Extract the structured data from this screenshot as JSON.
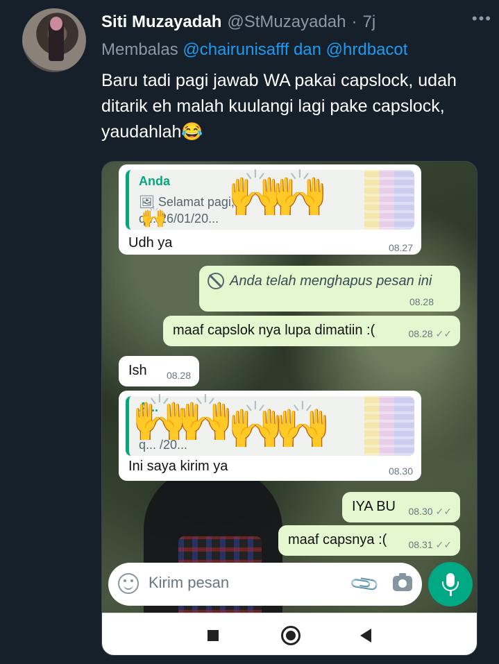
{
  "tweet": {
    "author_name": "Siti Muzayadah",
    "author_handle": "@StMuzayadah",
    "separator": "·",
    "time_ago": "7j",
    "more_label": "•••",
    "replying_prefix": "Membalas",
    "replying_to": "@chairunisafff dan @hrdbacot",
    "text": "Baru tadi pagi jawab WA pakai capslock, udah ditarik eh malah kuulangi lagi pake capslock, yaudahlah😂"
  },
  "chat": {
    "messages": [
      {
        "direction": "in",
        "quote": {
          "author": "Anda",
          "line1": "🖼 Selamat pagi, ...",
          "line2": "q... 26/01/20..."
        },
        "text": "Udh ya",
        "time": "08.27"
      },
      {
        "direction": "out",
        "deleted": true,
        "deleted_icon": "prohibited-icon",
        "text": "Anda telah menghapus pesan ini",
        "time": "08.28"
      },
      {
        "direction": "out",
        "text": "maaf capslok nya lupa dimatiin :(",
        "time": "08.28",
        "ticks": "✓✓"
      },
      {
        "direction": "in",
        "text": "Ish",
        "time": "08.28"
      },
      {
        "direction": "in",
        "quote": {
          "author": "A...",
          "line1": "...",
          "line2": "q... /20..."
        },
        "text": "Ini saya kirim ya",
        "time": "08.30"
      },
      {
        "direction": "out",
        "text": "IYA BU",
        "time": "08.30",
        "ticks": "✓✓"
      },
      {
        "direction": "out",
        "text": "maaf capsnya :(",
        "time": "08.31",
        "ticks": "✓✓"
      }
    ],
    "input_placeholder": "Kirim pesan",
    "censor_emoji": "🙌"
  },
  "colors": {
    "background": "#15202b",
    "link": "#1d9bf0",
    "whatsapp_green": "#00a884",
    "outgoing_bubble": "#e3f8cf"
  }
}
